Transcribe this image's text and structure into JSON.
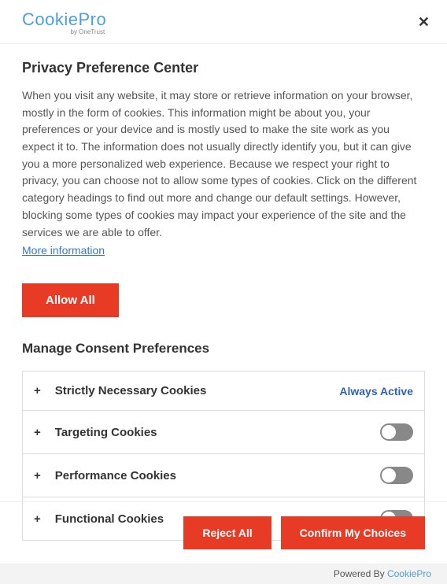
{
  "logo": {
    "main": "CookiePro",
    "sub": "by OneTrust"
  },
  "title": "Privacy Preference Center",
  "description": "When you visit any website, it may store or retrieve information on your browser, mostly in the form of cookies. This information might be about you, your preferences or your device and is mostly used to make the site work as you expect it to. The information does not usually directly identify you, but it can give you a more personalized web experience. Because we respect your right to privacy, you can choose not to allow some types of cookies. Click on the different category headings to find out more and change our default settings. However, blocking some types of cookies may impact your experience of the site and the services we are able to offer.",
  "more_info": "More information",
  "allow_all": "Allow All",
  "manage_title": "Manage Consent Preferences",
  "categories": {
    "strictly_necessary": {
      "label": "Strictly Necessary Cookies",
      "status": "Always Active"
    },
    "targeting": {
      "label": "Targeting Cookies"
    },
    "performance": {
      "label": "Performance Cookies"
    },
    "functional": {
      "label": "Functional Cookies"
    }
  },
  "footer": {
    "reject": "Reject All",
    "confirm": "Confirm My Choices",
    "powered_prefix": "Powered By ",
    "powered_brand": "CookiePro"
  }
}
